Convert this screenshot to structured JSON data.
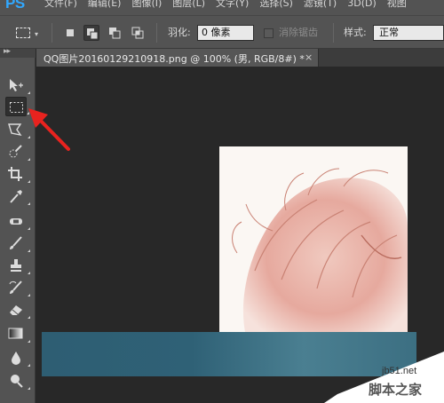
{
  "app": {
    "logo": "PS"
  },
  "menubar": {
    "items": [
      "文件(F)",
      "编辑(E)",
      "图像(I)",
      "图层(L)",
      "文字(Y)",
      "选择(S)",
      "滤镜(T)",
      "3D(D)",
      "视图"
    ]
  },
  "options": {
    "feather_label": "羽化:",
    "feather_value": "0 像素",
    "antialias_label": "消除锯齿",
    "style_label": "样式:",
    "style_value": "正常"
  },
  "document": {
    "tab_title": "QQ图片20160129210918.png @ 100% (男, RGB/8#) *",
    "close_glyph": "×"
  },
  "toolbox": {
    "tools": [
      {
        "name": "move-tool",
        "icon": "move-icon"
      },
      {
        "name": "rectangular-marquee-tool",
        "icon": "marquee-icon",
        "active": true
      },
      {
        "name": "lasso-tool",
        "icon": "lasso-icon"
      },
      {
        "name": "quick-selection-tool",
        "icon": "quick-selection-icon"
      },
      {
        "name": "crop-tool",
        "icon": "crop-icon"
      },
      {
        "name": "eyedropper-tool",
        "icon": "eyedropper-icon"
      },
      {
        "name": "spot-healing-tool",
        "icon": "bandage-icon"
      },
      {
        "name": "brush-tool",
        "icon": "brush-icon"
      },
      {
        "name": "clone-stamp-tool",
        "icon": "stamp-icon"
      },
      {
        "name": "history-brush-tool",
        "icon": "history-brush-icon"
      },
      {
        "name": "eraser-tool",
        "icon": "eraser-icon"
      },
      {
        "name": "gradient-tool",
        "icon": "gradient-icon"
      },
      {
        "name": "blur-tool",
        "icon": "drop-icon"
      },
      {
        "name": "dodge-tool",
        "icon": "dodge-icon"
      }
    ]
  },
  "watermark": {
    "site": "jb51.net",
    "text": "脚本之家"
  },
  "colors": {
    "ps_blue": "#31a8ff",
    "annotation_red": "#e8231f",
    "banner": "#2f6176"
  }
}
